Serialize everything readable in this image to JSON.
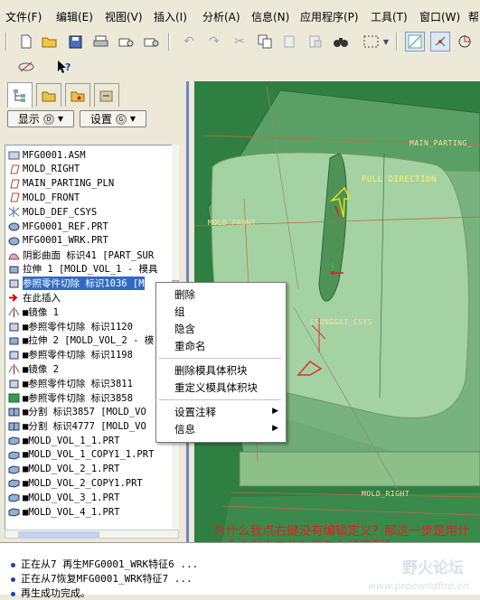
{
  "menubar": {
    "items": [
      "文件(F)",
      "编辑(E)",
      "视图(V)",
      "插入(I)",
      "分析(A)",
      "信息(N)",
      "应用程序(P)",
      "工具(T)",
      "窗口(W)",
      "帮"
    ]
  },
  "left_panel": {
    "show_button": "显示",
    "settings_button": "设置",
    "tree_items": [
      {
        "label": "MFG0001.ASM",
        "icon": "assembly-icon"
      },
      {
        "label": "MOLD_RIGHT",
        "icon": "datum-plane-icon"
      },
      {
        "label": "MAIN_PARTING_PLN",
        "icon": "datum-plane-icon"
      },
      {
        "label": "MOLD_FRONT",
        "icon": "datum-plane-icon"
      },
      {
        "label": "MOLD_DEF_CSYS",
        "icon": "csys-icon"
      },
      {
        "label": "MFG0001_REF.PRT",
        "icon": "ref-part-icon"
      },
      {
        "label": "MFG0001_WRK.PRT",
        "icon": "workpiece-icon"
      },
      {
        "label": "阴影曲面 标识41 [PART_SUR",
        "icon": "shadow-surface-icon"
      },
      {
        "label": "拉伸 1 [MOLD_VOL_1 - 模具",
        "icon": "extrude-icon"
      },
      {
        "label": "参照零件切除 标识1036 [M",
        "icon": "ref-cut-icon"
      },
      {
        "label": "在此插入",
        "icon": "insert-here-icon"
      },
      {
        "label": "■镜像 1",
        "icon": "mirror-icon"
      },
      {
        "label": "■参照零件切除 标识1120",
        "icon": "ref-cut-icon"
      },
      {
        "label": "■拉伸 2 [MOLD_VOL_2 - 模",
        "icon": "extrude-icon"
      },
      {
        "label": "■参照零件切除 标识1198",
        "icon": "ref-cut-icon"
      },
      {
        "label": "■镜像 2",
        "icon": "mirror-icon"
      },
      {
        "label": "■参照零件切除 标识3811",
        "icon": "ref-cut-icon"
      },
      {
        "label": "■参照零件切除 标识3858",
        "icon": "ref-cut-green-icon"
      },
      {
        "label": "■分割 标识3857 [MOLD_VO",
        "icon": "split-icon"
      },
      {
        "label": "■分割 标识4777 [MOLD_VO",
        "icon": "split-icon"
      },
      {
        "label": "■MOLD_VOL_1_1.PRT",
        "icon": "part-icon"
      },
      {
        "label": "■MOLD_VOL_1_COPY1_1.PRT",
        "icon": "part-icon"
      },
      {
        "label": "■MOLD_VOL_2_1.PRT",
        "icon": "part-icon"
      },
      {
        "label": "■MOLD_VOL_2_COPY1.PRT",
        "icon": "part-icon"
      },
      {
        "label": "■MOLD_VOL_3_1.PRT",
        "icon": "part-icon"
      },
      {
        "label": "■MOLD_VOL_4_1.PRT",
        "icon": "part-icon"
      }
    ],
    "selected_index": 9
  },
  "context_menu": {
    "items": [
      "删除",
      "组",
      "隐含",
      "重命名",
      "删除模具体积块",
      "重定义模具体积块",
      "设置注释",
      "信息"
    ]
  },
  "viewport": {
    "labels": [
      "MAIN_PARTING_",
      "PULL DIRECTION",
      "MOLD_FRONT",
      "CSONGGAI_CSYS",
      "MOLD_RIGHT"
    ],
    "colors": {
      "dark": "#2d7a3e",
      "mid": "#5aa668",
      "light": "#9fcc9d"
    }
  },
  "annotation": "为什么我点右键没有编辑定义？那这一步是用什么命令做出来的？我怎么找不到？",
  "status": {
    "messages": [
      "正在从7 再生MFG0001_WRK特征6 ...",
      "正在从7恢复MFG0001_WRK特征7 ...",
      "再生成功完成。"
    ]
  },
  "watermark": {
    "brand": "野火论坛",
    "url": "www.proewildfire.cn"
  }
}
